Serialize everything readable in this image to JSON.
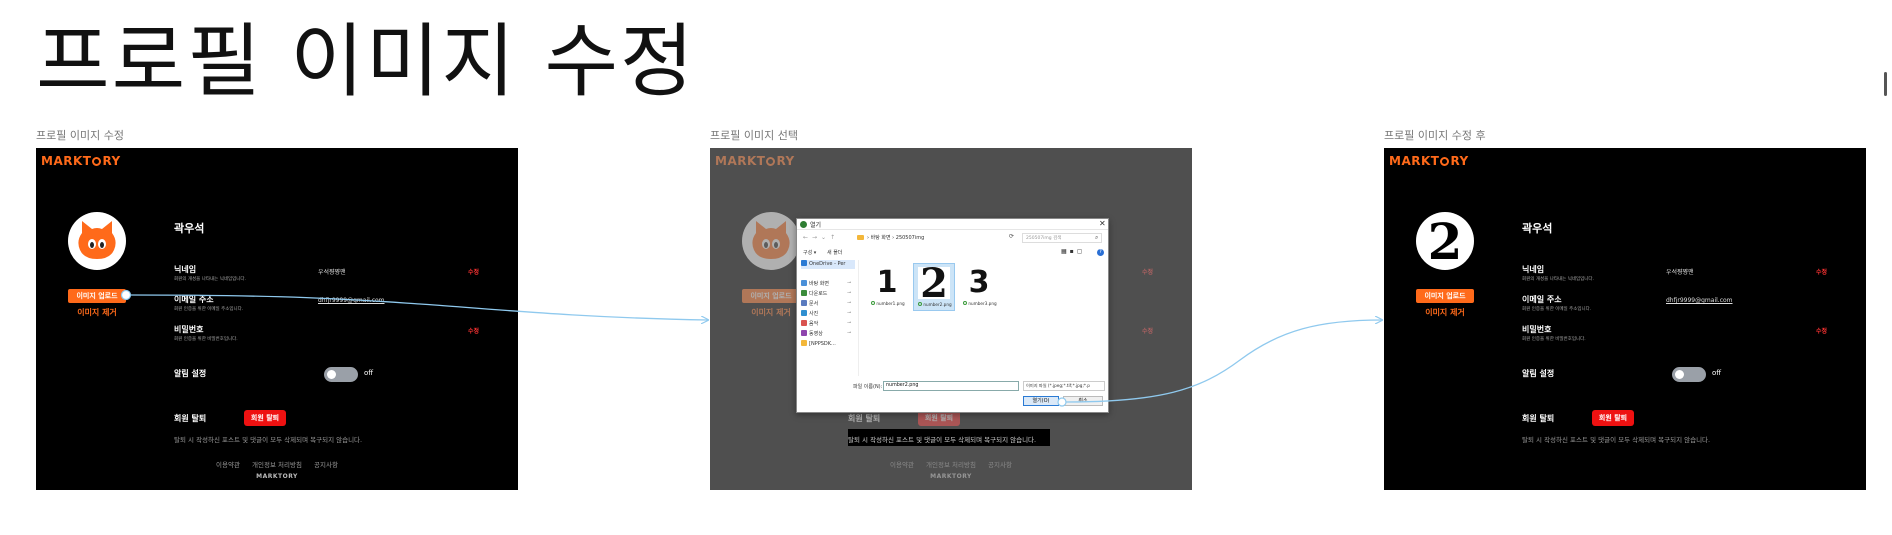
{
  "page_title": "프로필 이미지 수정",
  "colors": {
    "brand": "#ff6a1a",
    "danger": "#ee1111",
    "connector": "#8fc9ee"
  },
  "frames": [
    {
      "label": "프로필 이미지 수정"
    },
    {
      "label": "프로필 이미지 선택"
    },
    {
      "label": "프로필 이미지 수정 후"
    }
  ],
  "profile": {
    "logo": "MARKT",
    "logo_suffix": "RY",
    "avatar_icon": "cat-face-icon",
    "avatar_after": "2",
    "upload_label": "이미지 업로드",
    "remove_label": "이미지 제거",
    "user_name": "곽우석",
    "nickname_label": "닉네임",
    "nickname_desc": "회원의 개성을 나타내는 닉네임입니다.",
    "nickname_value": "우석쨩쨩맨",
    "email_label": "이메일 주소",
    "email_desc": "회원 인증을 위한 이메일 주소입니다.",
    "email_value": "dhfjr9999@gmail.com",
    "password_label": "비밀번호",
    "password_desc": "회원 인증을 위한 비밀번호입니다.",
    "edit_label": "수정",
    "notification_label": "알림 설정",
    "notification_state": "off",
    "withdraw_label": "회원 탈퇴",
    "withdraw_button": "회원 탈퇴",
    "withdraw_notice": "탈퇴 시 작성하신 포스트 및 댓글이 모두 삭제되며 복구되지 않습니다.",
    "footer_links": [
      "이용약관",
      "개인정보 처리방침",
      "공지사항"
    ],
    "footer_logo": "MARKTORY"
  },
  "dialog": {
    "title": "열기",
    "path": "› 바탕 화면 › 250507img",
    "search_placeholder": "250507img 검색",
    "organize": "구성 ▾",
    "new_folder": "새 폴더",
    "sidebar": [
      {
        "label": "OneDrive - Per",
        "icon_color": "#2a7ad4"
      },
      {
        "label": "바탕 화면",
        "icon_color": "#4a90d9"
      },
      {
        "label": "다운로드",
        "icon_color": "#3b8c3b"
      },
      {
        "label": "문서",
        "icon_color": "#5a7bbf"
      },
      {
        "label": "사진",
        "icon_color": "#2f8fd0"
      },
      {
        "label": "음악",
        "icon_color": "#d9534f"
      },
      {
        "label": "동영상",
        "icon_color": "#8e44ad"
      },
      {
        "label": "[NPPSDK...",
        "icon_color": "#f3b73a"
      }
    ],
    "files": [
      {
        "thumb": "1",
        "name": "number1.png"
      },
      {
        "thumb": "2",
        "name": "number2.png"
      },
      {
        "thumb": "3",
        "name": "number3.png"
      }
    ],
    "filename_label": "파일 이름(N):",
    "filename_value": "number2.png",
    "filetype": "이미지 파일 (*.jpeg;*.tif;*.jpg;*.p",
    "open_label": "열기(O)",
    "cancel_label": "취소"
  }
}
